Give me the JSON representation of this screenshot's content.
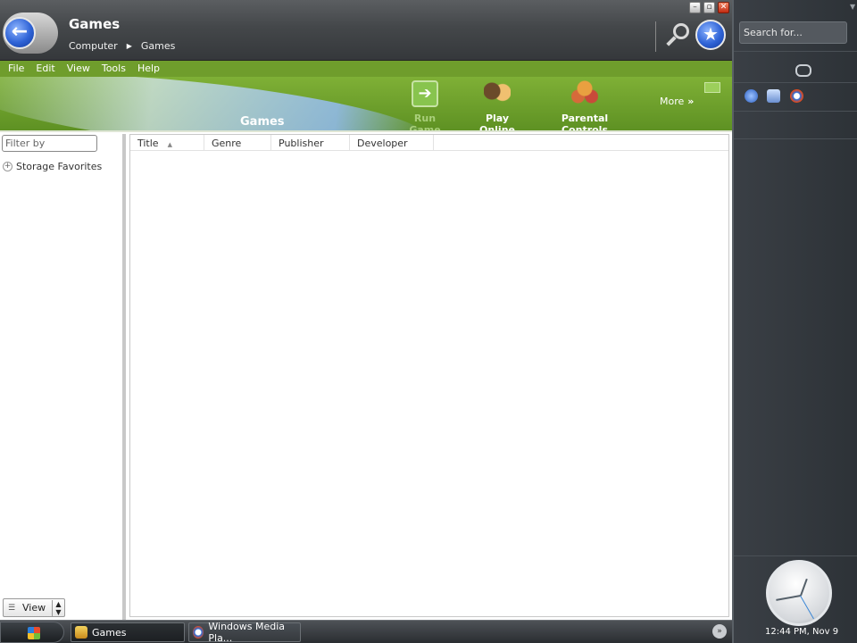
{
  "window": {
    "title": "Games",
    "breadcrumb": [
      "Computer",
      "Games"
    ],
    "controls": {
      "minimize": "–",
      "maximize": "▫",
      "close": "✕"
    }
  },
  "menu": [
    "File",
    "Edit",
    "View",
    "Tools",
    "Help"
  ],
  "banner": {
    "title": "Games",
    "tools": {
      "run": "Run Game",
      "online": "Play Online",
      "parental": "Parental Controls"
    },
    "more": "More"
  },
  "nav": {
    "filter_placeholder": "Filter by",
    "tree_item": "Storage Favorites",
    "view_label": "View"
  },
  "list": {
    "columns": [
      "Title",
      "Genre",
      "Publisher",
      "Developer"
    ],
    "sort_column": "Title"
  },
  "taskbar": {
    "tasks": [
      "Games",
      "Windows Media Pla..."
    ]
  },
  "sidebar": {
    "search_placeholder": "Search for...",
    "clock_text": "12:44 PM, Nov 9"
  },
  "colors": {
    "banner_green": "#6f9d2c",
    "titlebar_dark": "#44474a",
    "accent_blue": "#2f63d6"
  }
}
